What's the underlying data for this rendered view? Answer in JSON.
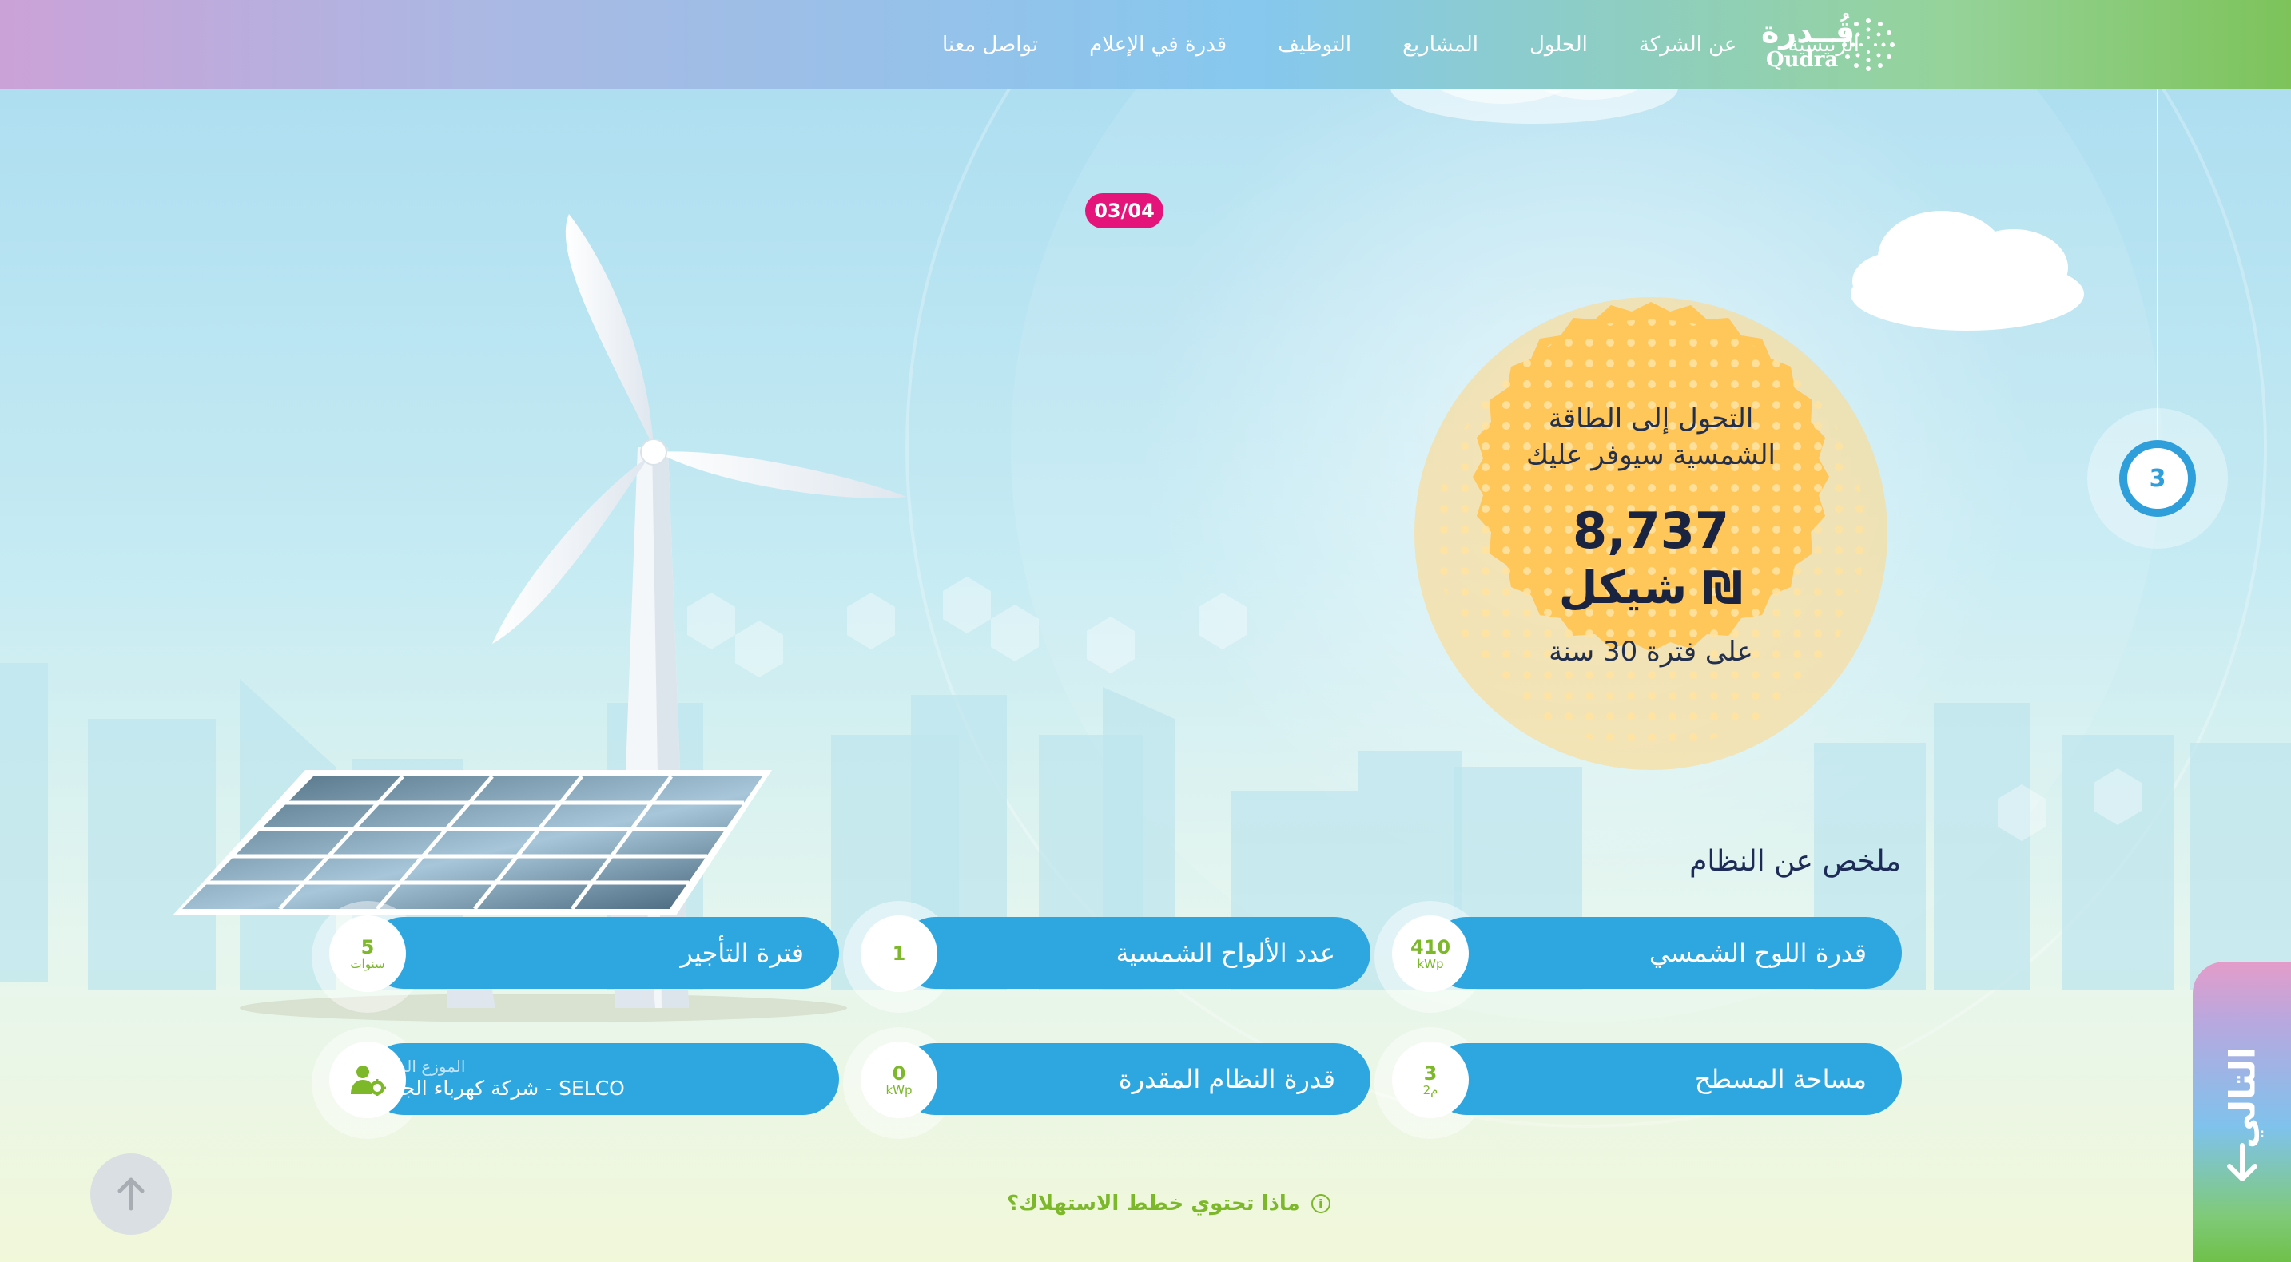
{
  "header": {
    "logo": {
      "arabic": "قُــدرة",
      "latin": "Qudra"
    },
    "nav": [
      {
        "label": "الرئيسية"
      },
      {
        "label": "عن الشركة"
      },
      {
        "label": "الحلول"
      },
      {
        "label": "المشاريع"
      },
      {
        "label": "التوظيف"
      },
      {
        "label": "قدرة في الإعلام"
      },
      {
        "label": "تواصل معنا"
      }
    ]
  },
  "slide_counter": "03/04",
  "step_indicator": "3",
  "savings": {
    "line1": "التحول إلى الطاقة",
    "line2": "الشمسية سيوفر عليك",
    "amount": "8,737",
    "currency": "₪ شيكل",
    "period": "على فترة 30 سنة"
  },
  "summary": {
    "title": "ملخص عن النظام",
    "items": [
      {
        "label": "قدرة اللوح الشمسي",
        "value": "410",
        "unit": "kWp"
      },
      {
        "label": "عدد الألواح الشمسية",
        "value": "1",
        "unit": ""
      },
      {
        "label": "فترة التأجير",
        "value": "5",
        "unit": "سنوات"
      },
      {
        "label": "مساحة المسطح",
        "value": "3",
        "unit": "2م"
      },
      {
        "label": "قدرة النظام المقدرة",
        "value": "0",
        "unit": "kWp"
      },
      {
        "label_small": "الموزع المعتمد",
        "label": "SELCO - شركة كهرباء الجنوب",
        "icon": "user-gear-icon"
      }
    ]
  },
  "plans_link": "ماذا تحتوي خطط الاستهلاك؟",
  "next_tab": "التالي",
  "colors": {
    "pill": "#2ea6e0",
    "accent_green": "#7cb82a",
    "badge_pink": "#e5147a",
    "sun": "#ffc65a",
    "step_blue": "#2e9fdb"
  }
}
